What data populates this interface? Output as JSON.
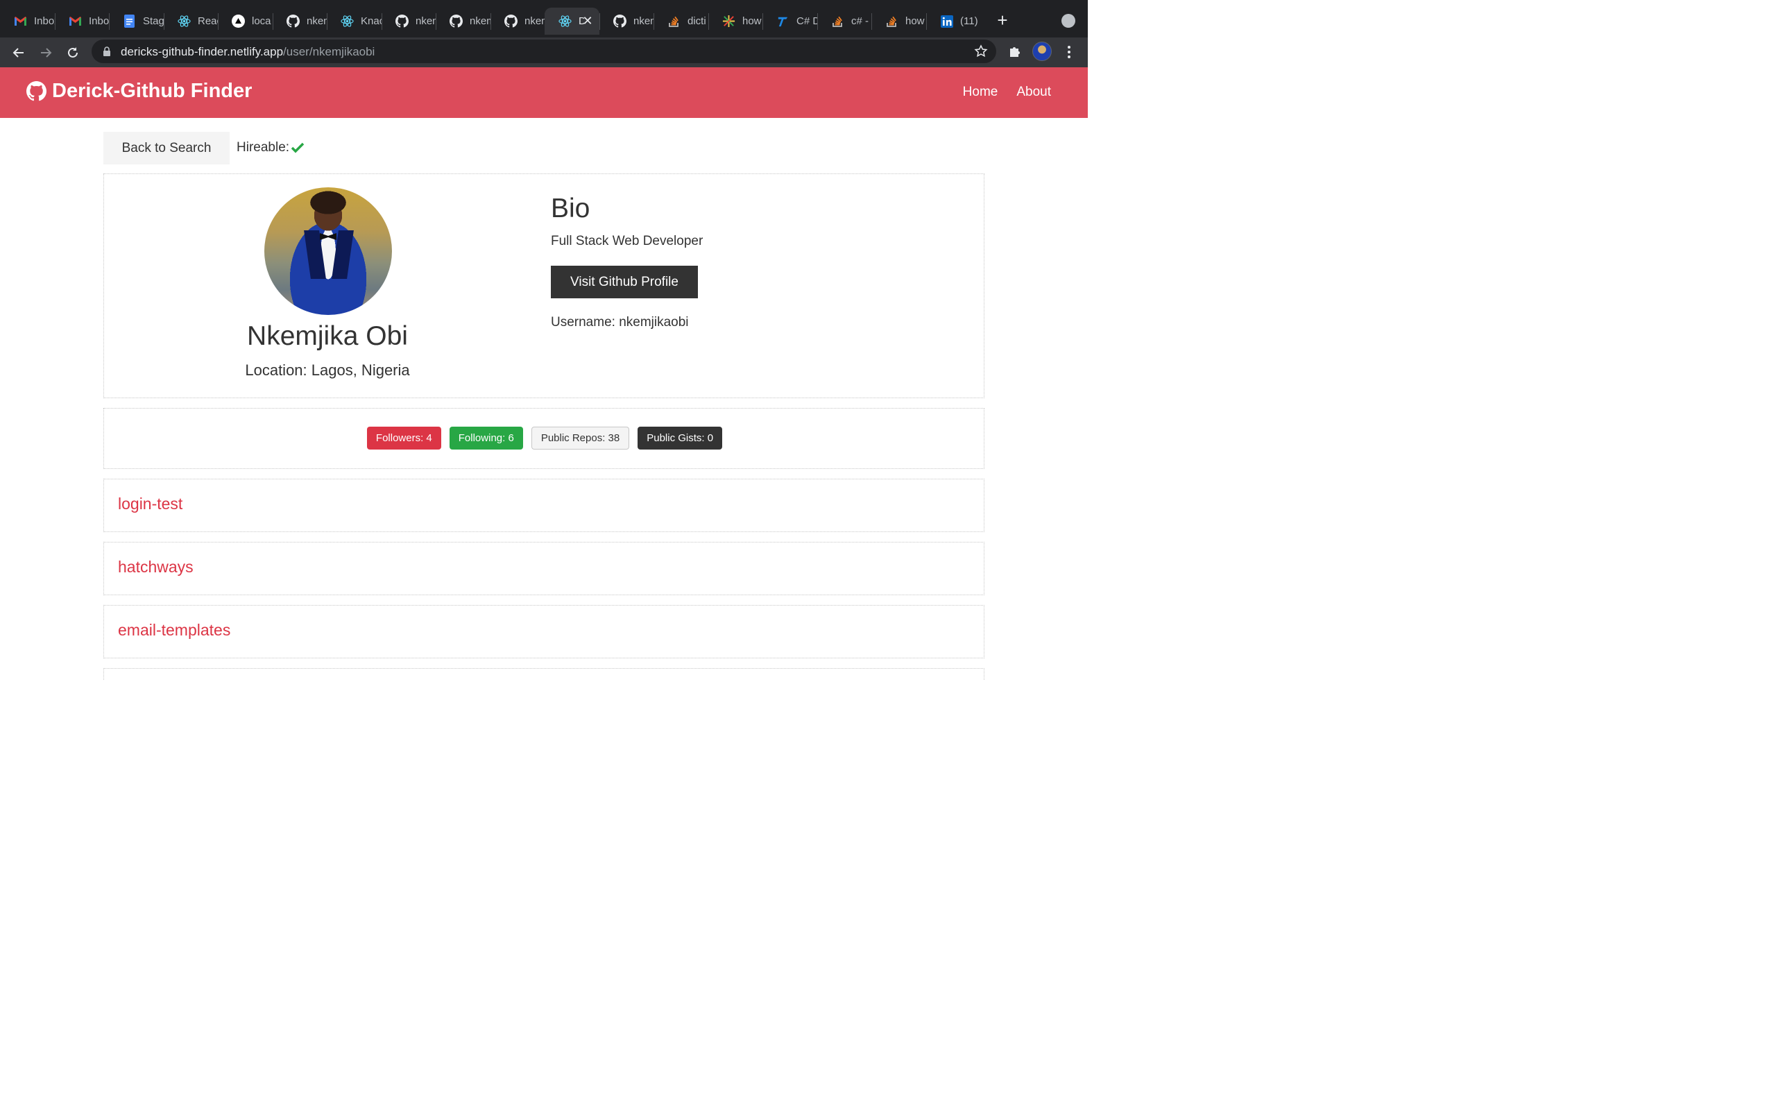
{
  "browser": {
    "tabs": [
      {
        "title": "Inbox",
        "icon": "gmail-icon"
      },
      {
        "title": "Inbox",
        "icon": "gmail-icon"
      },
      {
        "title": "Stag",
        "icon": "google-docs-icon"
      },
      {
        "title": "React",
        "icon": "react-icon"
      },
      {
        "title": "loca",
        "icon": "vercel-icon"
      },
      {
        "title": "nkem",
        "icon": "github-icon"
      },
      {
        "title": "Knac",
        "icon": "react-icon"
      },
      {
        "title": "nkem",
        "icon": "github-icon"
      },
      {
        "title": "nkem",
        "icon": "github-icon"
      },
      {
        "title": "nkem",
        "icon": "github-icon"
      },
      {
        "title": "D",
        "icon": "react-icon",
        "active": true
      },
      {
        "title": "nkem",
        "icon": "github-icon"
      },
      {
        "title": "dicti",
        "icon": "stackoverflow-icon"
      },
      {
        "title": "how",
        "icon": "sparkle-icon"
      },
      {
        "title": "C# D",
        "icon": "tutorialsteacher-icon"
      },
      {
        "title": "c# -",
        "icon": "stackoverflow-icon"
      },
      {
        "title": "how",
        "icon": "stackoverflow-icon"
      },
      {
        "title": "(11)",
        "icon": "linkedin-icon"
      }
    ],
    "url_host": "dericks-github-finder.netlify.app",
    "url_path": "/user/nkemjikaobi"
  },
  "navbar": {
    "brand": "Derick-Github Finder",
    "links": [
      "Home",
      "About"
    ]
  },
  "actions": {
    "back_label": "Back to Search",
    "hireable_label": "Hireable:"
  },
  "profile": {
    "name": "Nkemjika Obi",
    "location": "Location: Lagos, Nigeria",
    "bio_heading": "Bio",
    "bio": "Full Stack Web Developer",
    "visit_label": "Visit Github Profile",
    "username": "Username: nkemjikaobi"
  },
  "stats": {
    "followers": "Followers: 4",
    "following": "Following: 6",
    "repos": "Public Repos: 38",
    "gists": "Public Gists: 0"
  },
  "repos": [
    "login-test",
    "hatchways",
    "email-templates"
  ],
  "colors": {
    "navbar": "#dc4b5b",
    "danger": "#dc3545",
    "success": "#28a745",
    "dark": "#333333",
    "light": "#f4f4f4"
  }
}
